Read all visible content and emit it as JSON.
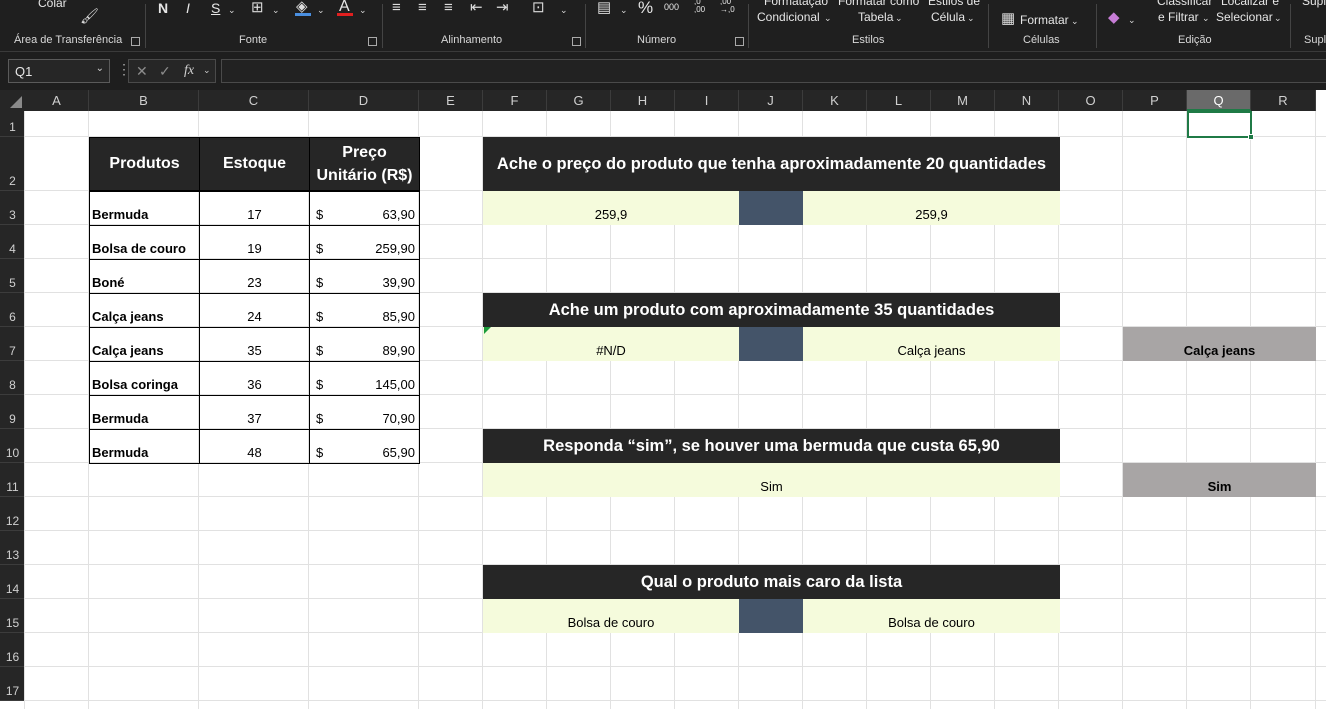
{
  "ribbon": {
    "colar": "Colar",
    "font_buttons": [
      "N",
      "I",
      "S"
    ],
    "font_color_letter": "A",
    "percent": "%",
    "thousands": "000",
    "dec_inc": ",0\n,00",
    "dec_dec": ",00\n→,0",
    "cond_format_1": "Formatação",
    "cond_format_2": "Condicional",
    "format_table_1": "Formatar como",
    "format_table_2": "Tabela",
    "cell_styles_1": "Estilos de",
    "cell_styles_2": "Célula",
    "format_cells": "Formatar",
    "sort_filter_1": "Classificar",
    "sort_filter_2": "e Filtrar",
    "find_select_1": "Localizar e",
    "find_select_2": "Selecionar",
    "addin_partial": "Supl",
    "groups": [
      "Área de Transferência",
      "Fonte",
      "Alinhamento",
      "Número",
      "Estilos",
      "Células",
      "Edição",
      "Supl"
    ]
  },
  "formula_bar": {
    "name_box": "Q1",
    "cancel": "✕",
    "enter": "✓",
    "fx": "fx",
    "value": ""
  },
  "columns": [
    "A",
    "B",
    "C",
    "D",
    "E",
    "F",
    "G",
    "H",
    "I",
    "J",
    "K",
    "L",
    "M",
    "N",
    "O",
    "P",
    "Q",
    "R"
  ],
  "rows": [
    "1",
    "2",
    "3",
    "4",
    "5",
    "6",
    "7",
    "8",
    "9",
    "10",
    "11",
    "12",
    "13",
    "14",
    "15",
    "16",
    "17"
  ],
  "selected_cell": "Q1",
  "table": {
    "headers": [
      "Produtos",
      "Estoque",
      "Preço Unitário (R$)"
    ],
    "header_price_line1": "Preço",
    "header_price_line2": "Unitário (R$)",
    "currency": "$",
    "rows": [
      {
        "produto": "Bermuda",
        "estoque": "17",
        "preco": "63,90"
      },
      {
        "produto": "Bolsa de couro",
        "estoque": "19",
        "preco": "259,90"
      },
      {
        "produto": "Boné",
        "estoque": "23",
        "preco": "39,90"
      },
      {
        "produto": "Calça jeans",
        "estoque": "24",
        "preco": "85,90"
      },
      {
        "produto": "Calça jeans",
        "estoque": "35",
        "preco": "89,90"
      },
      {
        "produto": "Bolsa coringa",
        "estoque": "36",
        "preco": "145,00"
      },
      {
        "produto": "Bermuda",
        "estoque": "37",
        "preco": "70,90"
      },
      {
        "produto": "Bermuda",
        "estoque": "48",
        "preco": "65,90"
      }
    ]
  },
  "questions": [
    {
      "title": "Ache o preço do produto que tenha aproximadamente 20 quantidades",
      "left": "259,9",
      "right": "259,9"
    },
    {
      "title": "Ache um produto com aproximadamente 35 quantidades",
      "left": "#N/D",
      "right": "Calça jeans",
      "side": "Calça jeans"
    },
    {
      "title": "Responda “sim”, se houver uma bermuda que custa 65,90",
      "answer": "Sim",
      "side": "Sim"
    },
    {
      "title": "Qual o produto mais caro da lista",
      "left": "Bolsa de couro",
      "right": "Bolsa de couro"
    }
  ],
  "colors": {
    "header_dark": "#262626",
    "answer_bg": "#f5fbdc",
    "divider_blue": "#445469",
    "side_grey": "#a8a5a5",
    "selection_green": "#1f7a46"
  }
}
